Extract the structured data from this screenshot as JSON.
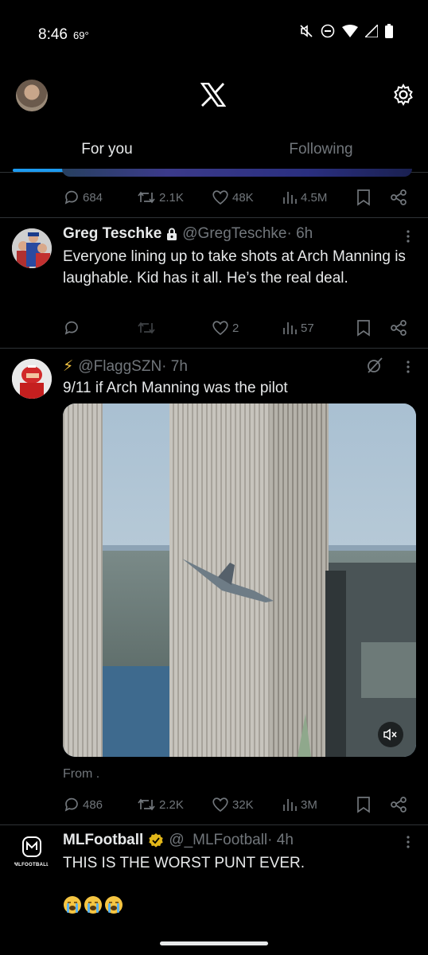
{
  "status_bar": {
    "time": "8:46",
    "temperature": "69°",
    "icons": [
      "mute-icon",
      "dnd-icon",
      "wifi-icon",
      "signal-icon",
      "battery-icon"
    ]
  },
  "header": {
    "logo": "x-logo-icon",
    "settings_icon": "gear-icon"
  },
  "tabs": [
    {
      "label": "For you",
      "active": true
    },
    {
      "label": "Following",
      "active": false
    }
  ],
  "accent_color": "#1d9bf0",
  "prev_tweet": {
    "replies": "684",
    "reposts": "2.1K",
    "likes": "48K",
    "views": "4.5M"
  },
  "tweets": [
    {
      "name": "Greg Teschke",
      "protected": true,
      "handle": "@GregTeschke",
      "time": "· 6h",
      "text": "Everyone lining up to take shots at Arch Manning is laughable. Kid has it all. He’s the real deal.",
      "replies": "",
      "reposts": "",
      "likes": "2",
      "views": "57"
    },
    {
      "name": "⚡",
      "handle": "@FlaggSZN",
      "time": "· 7h",
      "text": "9/11 if Arch Manning was the pilot",
      "from": "From .",
      "replies": "486",
      "reposts": "2.2K",
      "likes": "32K",
      "views": "3M"
    },
    {
      "name": "MLFootball",
      "verified": true,
      "handle": "@_MLFootball",
      "time": "· 4h",
      "text": "THIS IS THE WORST PUNT EVER.",
      "avatar_caption": "MLFOOTBALL"
    }
  ]
}
